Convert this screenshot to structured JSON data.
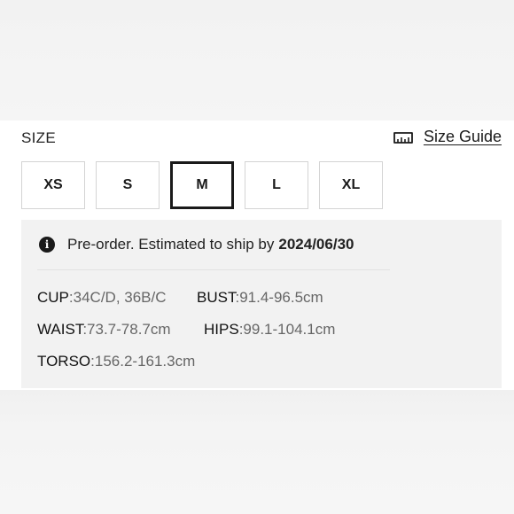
{
  "size_selector": {
    "label": "SIZE",
    "guide_label": "Size Guide",
    "guide_icon": "ruler-icon",
    "options": [
      "XS",
      "S",
      "M",
      "L",
      "XL"
    ],
    "selected": "M"
  },
  "notice": {
    "icon": "info-icon",
    "icon_glyph": "i",
    "text": "Pre-order. Estimated to ship by",
    "date": "2024/06/30"
  },
  "measurements": {
    "cup": {
      "label": "CUP",
      "value": ":34C/D, 36B/C"
    },
    "bust": {
      "label": "BUST",
      "value": ":91.4-96.5cm"
    },
    "waist": {
      "label": "WAIST",
      "value": ":73.7-78.7cm"
    },
    "hips": {
      "label": "HIPS",
      "value": ":99.1-104.1cm"
    },
    "torso": {
      "label": "TORSO",
      "value": ":156.2-161.3cm"
    }
  }
}
